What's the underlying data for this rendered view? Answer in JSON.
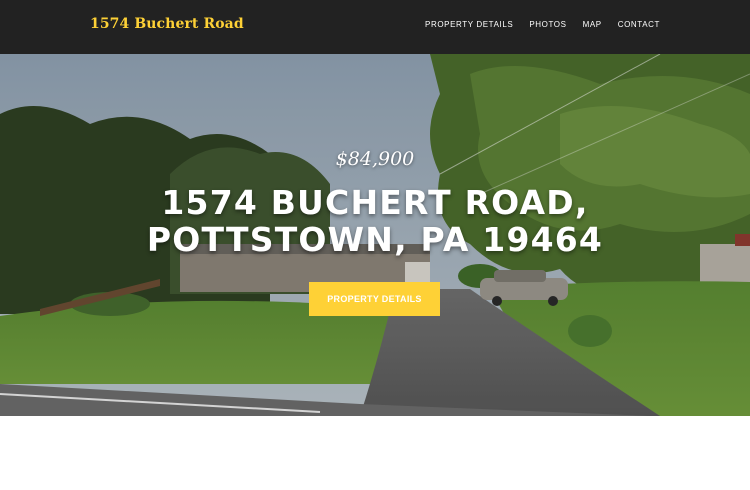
{
  "navbar": {
    "brand": "1574 Buchert Road",
    "links": [
      "PROPERTY DETAILS",
      "PHOTOS",
      "MAP",
      "CONTACT"
    ]
  },
  "hero": {
    "price": "$84,900",
    "address_line1": "1574 BUCHERT ROAD,",
    "address_line2": "POTTSTOWN, PA 19464",
    "cta_label": "PROPERTY DETAILS",
    "image": "street-view-house-photo"
  },
  "colors": {
    "accent": "#fed136",
    "navbar_bg": "#222222",
    "text_light": "#ffffff"
  }
}
